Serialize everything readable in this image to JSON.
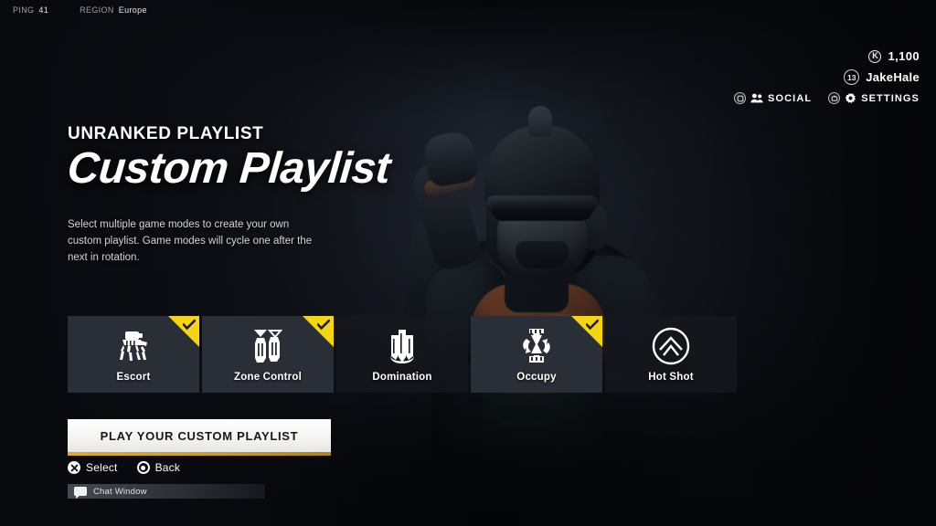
{
  "topbar": {
    "ping_key": "PING",
    "ping_value": "41",
    "region_key": "REGION",
    "region_value": "Europe"
  },
  "hud": {
    "currency_icon": "coin-icon",
    "currency_glyph": "K",
    "currency_amount": "1,100",
    "level": "13",
    "username": "JakeHale",
    "social_label": "SOCIAL",
    "social_icon": "friends-icon",
    "social_prompt_icon": "button-prompt-icon",
    "settings_label": "SETTINGS",
    "settings_icon": "gear-icon",
    "settings_prompt_icon": "button-prompt-icon"
  },
  "panel": {
    "kicker": "UNRANKED PLAYLIST",
    "title": "Custom Playlist",
    "description": "Select multiple game modes to create your own custom playlist. Game modes will cycle one after the next in rotation."
  },
  "modes": [
    {
      "label": "Escort",
      "icon": "robot-mule-icon",
      "selected": true
    },
    {
      "label": "Zone Control",
      "icon": "twin-beacons-icon",
      "selected": true
    },
    {
      "label": "Domination",
      "icon": "flag-crest-icon",
      "selected": false
    },
    {
      "label": "Occupy",
      "icon": "hourglass-arrows-icon",
      "selected": true
    },
    {
      "label": "Hot Shot",
      "icon": "circle-chevrons-icon",
      "selected": false
    }
  ],
  "play_button": {
    "label": "PLAY YOUR CUSTOM PLAYLIST"
  },
  "prompts": [
    {
      "label": "Select",
      "icon": "cross-button-icon"
    },
    {
      "label": "Back",
      "icon": "circle-button-icon"
    }
  ],
  "chat": {
    "label": "Chat Window",
    "icon": "chat-bubble-icon"
  },
  "colors": {
    "accent_yellow": "#f5d411",
    "underline_gold": "#d8ab2e",
    "card_selected_bg": "#2a2e37",
    "background": "#0e1117",
    "text_primary": "#ffffff"
  }
}
